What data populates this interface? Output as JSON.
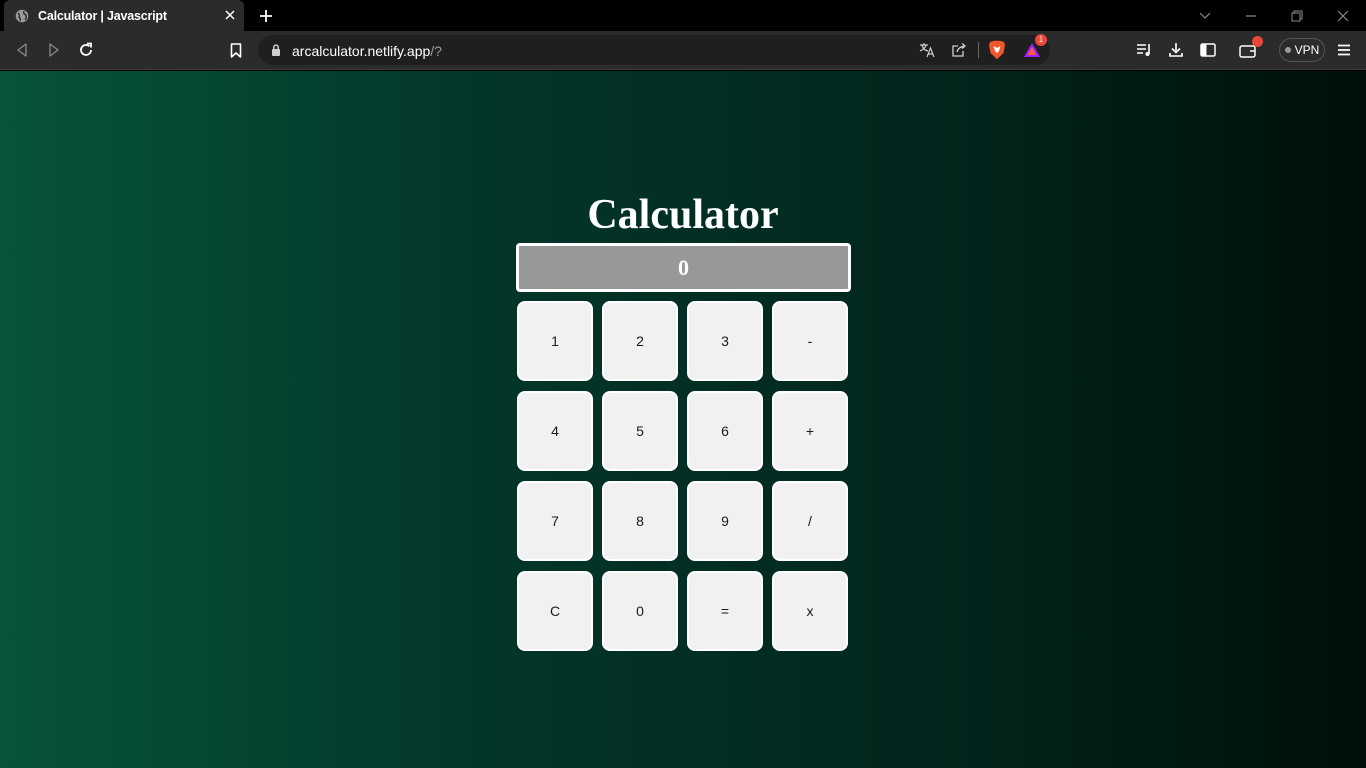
{
  "browser": {
    "tab": {
      "title": "Calculator | Javascript"
    },
    "address_bar": {
      "host": "arcalculator.netlify.app",
      "path": "/?"
    },
    "extensions": {
      "rewards_badge": "1"
    },
    "vpn_label": "VPN"
  },
  "calculator": {
    "title": "Calculator",
    "display": "0",
    "keys": [
      "1",
      "2",
      "3",
      "-",
      "4",
      "5",
      "6",
      "+",
      "7",
      "8",
      "9",
      "/",
      "C",
      "0",
      "=",
      "x"
    ]
  }
}
